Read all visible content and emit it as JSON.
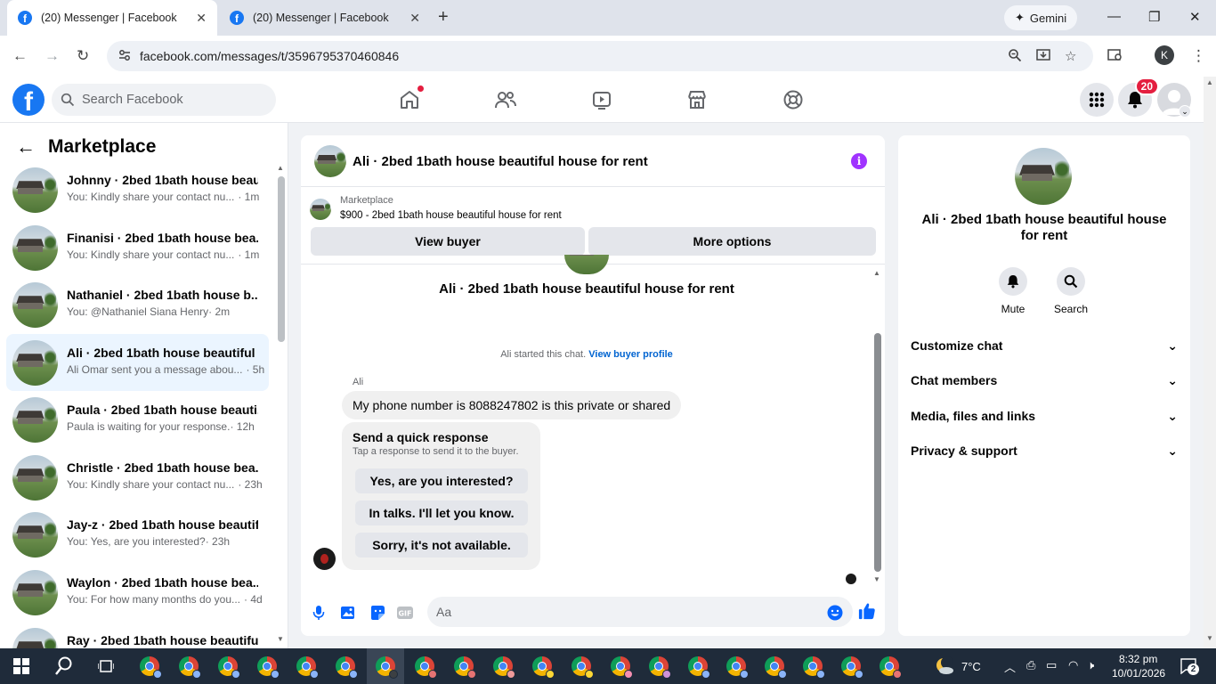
{
  "browser": {
    "tabs": [
      {
        "title": "(20) Messenger | Facebook",
        "active": true
      },
      {
        "title": "(20) Messenger | Facebook",
        "active": false
      }
    ],
    "gemini_label": "Gemini",
    "url": "facebook.com/messages/t/3596795370460846",
    "profile_initial": "K"
  },
  "fb": {
    "search_placeholder": "Search Facebook",
    "notification_count": "20"
  },
  "sidebar": {
    "title": "Marketplace",
    "conversations": [
      {
        "name": "Johnny · 2bed 1bath house beau...",
        "preview": "You: Kindly share your contact nu...",
        "time": "· 1m"
      },
      {
        "name": "Finanisi · 2bed 1bath house bea...",
        "preview": "You: Kindly share your contact nu...",
        "time": "· 1m"
      },
      {
        "name": "Nathaniel · 2bed 1bath house b...",
        "preview": "You: @Nathaniel Siana Henry",
        "time": "· 2m"
      },
      {
        "name": "Ali · 2bed 1bath house beautiful ...",
        "preview": "Ali Omar sent you a message abou...",
        "time": "· 5h"
      },
      {
        "name": "Paula · 2bed 1bath house beauti...",
        "preview": "Paula is waiting for your response.",
        "time": "· 12h"
      },
      {
        "name": "Christle · 2bed 1bath house bea...",
        "preview": "You: Kindly share your contact nu...",
        "time": "· 23h"
      },
      {
        "name": "Jay-z · 2bed 1bath house beautif...",
        "preview": "You: Yes, are you interested?",
        "time": "· 23h"
      },
      {
        "name": "Waylon · 2bed 1bath house bea...",
        "preview": "You: For how many months do you...",
        "time": "· 4d"
      },
      {
        "name": "Ray · 2bed 1bath house beautifu...",
        "preview": "",
        "time": ""
      }
    ]
  },
  "chat": {
    "title": "Ali · 2bed 1bath house beautiful house for rent",
    "marketplace_label": "Marketplace",
    "listing": "$900 - 2bed 1bath house beautiful house for rent",
    "view_buyer": "View buyer",
    "more_options": "More options",
    "started_text": "Ali started this chat.",
    "view_buyer_profile": "View buyer profile",
    "sender": "Ali",
    "message": "My phone number is 8088247802 is this private or shared",
    "quick_title": "Send a quick response",
    "quick_subtitle": "Tap a response to send it to the buyer.",
    "quick_responses": [
      "Yes, are you interested?",
      "In talks. I'll let you know.",
      "Sorry, it's not available."
    ],
    "composer_placeholder": "Aa"
  },
  "right_panel": {
    "title": "Ali · 2bed 1bath house beautiful house for rent",
    "mute": "Mute",
    "search": "Search",
    "sections": [
      "Customize chat",
      "Chat members",
      "Media, files and links",
      "Privacy & support"
    ]
  },
  "taskbar": {
    "temperature": "7°C",
    "time": "8:32 pm",
    "date": "10/01/2026",
    "notif_count": "2"
  },
  "colors": {
    "fb_blue": "#1877f2",
    "badge_red": "#e41e3f",
    "info_purple": "#a033ff",
    "link_blue": "#0064d1"
  }
}
